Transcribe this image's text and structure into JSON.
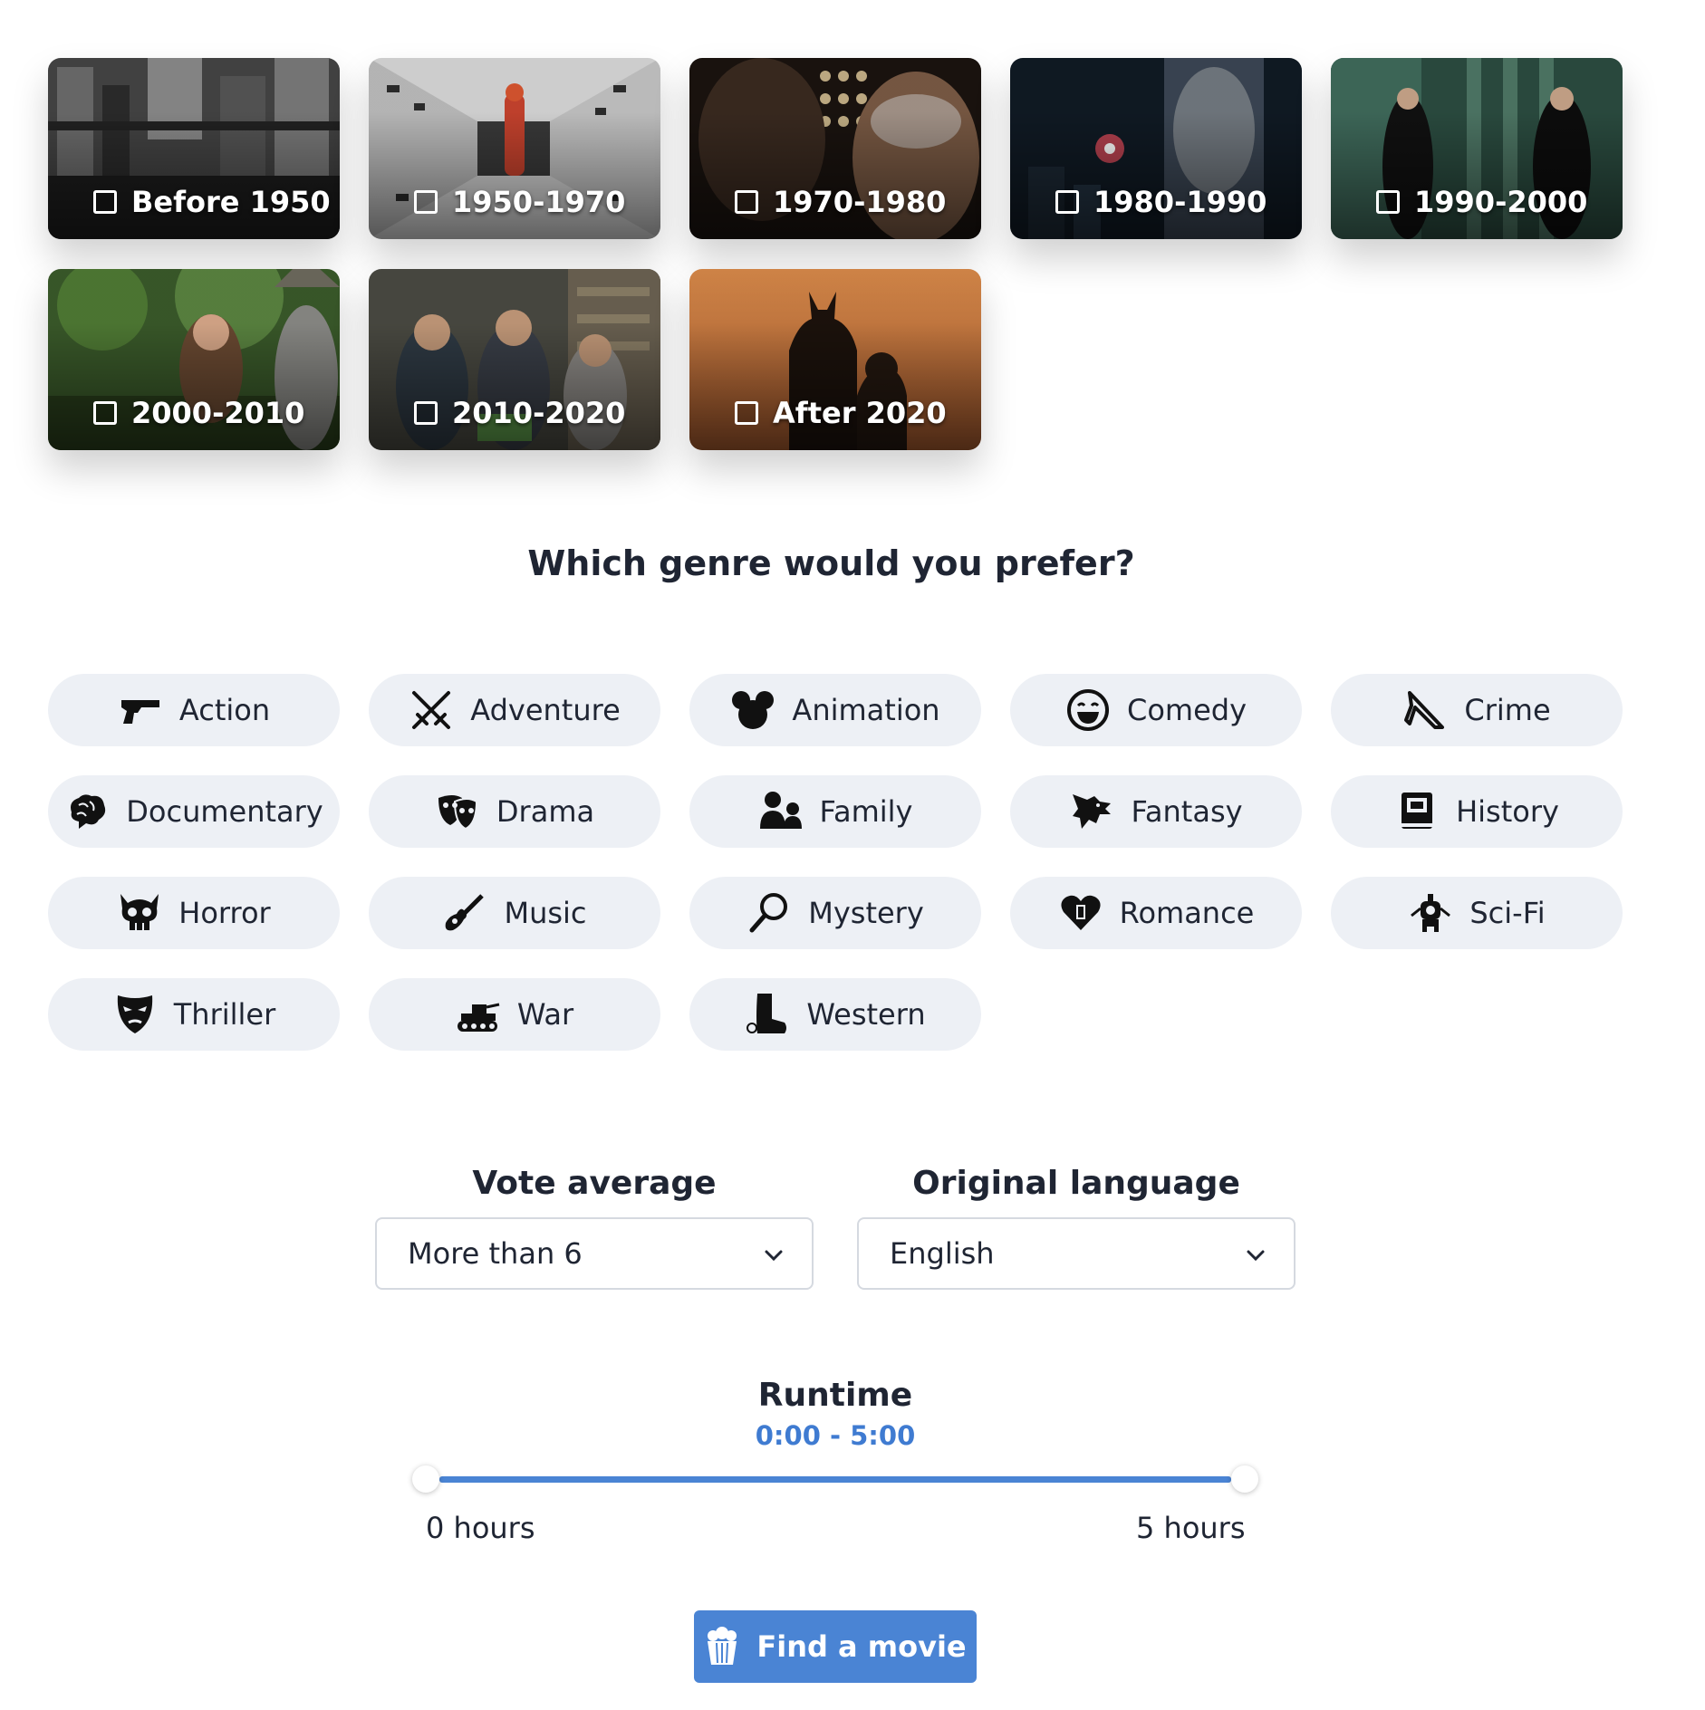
{
  "eras": [
    {
      "label": "Before 1950",
      "checked": false,
      "bg": "#3b3b3b"
    },
    {
      "label": "1950-1970",
      "checked": false,
      "bg": "#cfcfcf"
    },
    {
      "label": "1970-1980",
      "checked": false,
      "bg": "#2a1f18"
    },
    {
      "label": "1980-1990",
      "checked": false,
      "bg": "#16202c"
    },
    {
      "label": "1990-2000",
      "checked": false,
      "bg": "#1f3b33"
    },
    {
      "label": "2000-2010",
      "checked": false,
      "bg": "#2e4a22"
    },
    {
      "label": "2010-2020",
      "checked": false,
      "bg": "#3c3a34"
    },
    {
      "label": "After 2020",
      "checked": false,
      "bg": "#b9774a"
    }
  ],
  "genre_section": {
    "title": "Which genre would you prefer?"
  },
  "genres": [
    {
      "label": "Action",
      "icon": "pistol-icon"
    },
    {
      "label": "Adventure",
      "icon": "crossed-swords-icon"
    },
    {
      "label": "Animation",
      "icon": "mouse-ears-icon"
    },
    {
      "label": "Comedy",
      "icon": "laughing-face-icon"
    },
    {
      "label": "Crime",
      "icon": "knife-icon"
    },
    {
      "label": "Documentary",
      "icon": "brain-icon"
    },
    {
      "label": "Drama",
      "icon": "theater-masks-icon"
    },
    {
      "label": "Family",
      "icon": "family-icon"
    },
    {
      "label": "Fantasy",
      "icon": "dragon-icon"
    },
    {
      "label": "History",
      "icon": "book-icon"
    },
    {
      "label": "Horror",
      "icon": "skull-icon"
    },
    {
      "label": "Music",
      "icon": "guitar-icon"
    },
    {
      "label": "Mystery",
      "icon": "magnifier-icon"
    },
    {
      "label": "Romance",
      "icon": "heart-icon"
    },
    {
      "label": "Sci-Fi",
      "icon": "robot-icon"
    },
    {
      "label": "Thriller",
      "icon": "mask-icon"
    },
    {
      "label": "War",
      "icon": "tank-icon"
    },
    {
      "label": "Western",
      "icon": "cowboy-boot-icon"
    }
  ],
  "vote_average": {
    "label": "Vote average",
    "value": "More than 6"
  },
  "original_language": {
    "label": "Original language",
    "value": "English"
  },
  "runtime": {
    "title": "Runtime",
    "value": "0:00 - 5:00",
    "min_label": "0 hours",
    "max_label": "5 hours",
    "range_min_hours": 0,
    "range_max_hours": 5,
    "selected_min_hours": 0,
    "selected_max_hours": 5
  },
  "find_button": {
    "label": "Find a movie",
    "icon": "popcorn-icon"
  },
  "colors": {
    "accent": "#4a84d4",
    "pill_bg": "#edf0f5",
    "text": "#1f2533"
  }
}
